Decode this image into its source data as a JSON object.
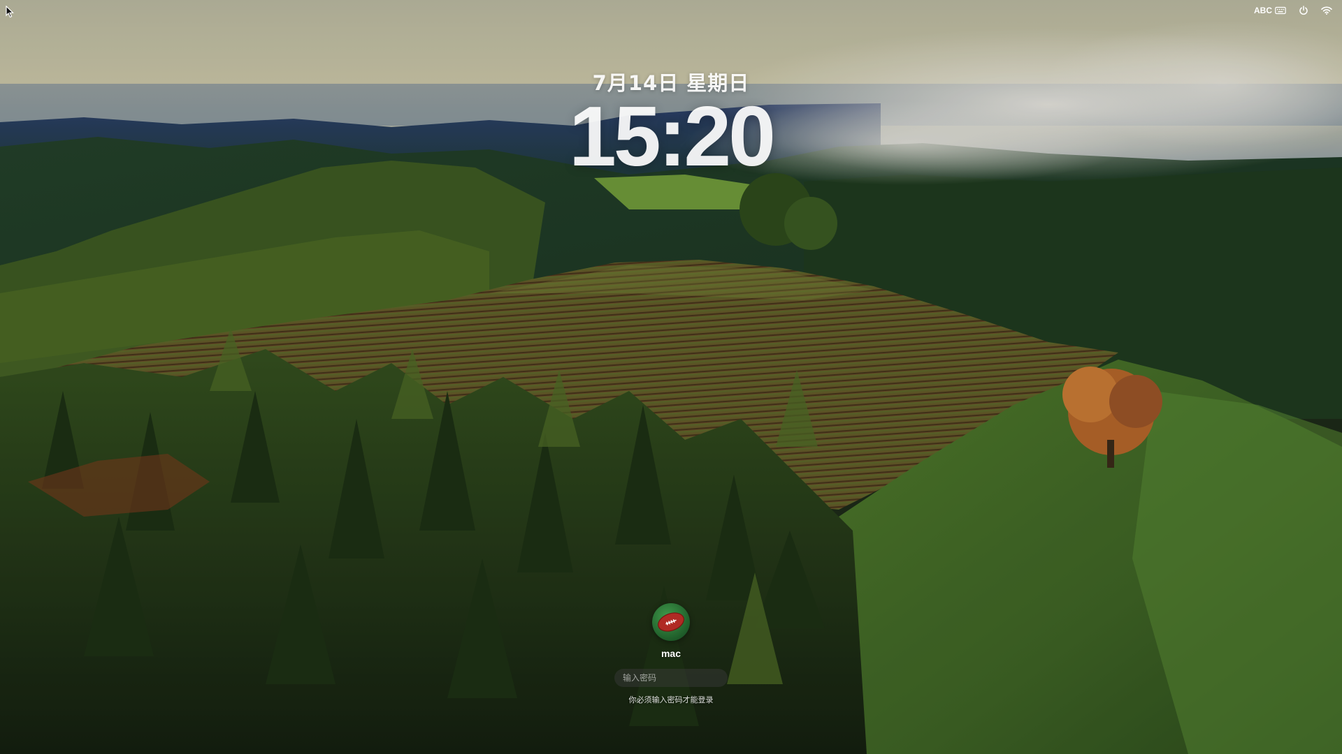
{
  "status_bar": {
    "input_source": "ABC",
    "icons": [
      "keyboard-icon",
      "power-icon",
      "wifi-icon"
    ]
  },
  "lock": {
    "date": "7月14日 星期日",
    "time": "15:20"
  },
  "user": {
    "name": "mac",
    "avatar": "football-avatar"
  },
  "login": {
    "password_placeholder": "输入密码",
    "hint": "你必须输入密码才能登录"
  },
  "colors": {
    "text": "#ffffff",
    "field_bg": "#3c3c3c"
  }
}
